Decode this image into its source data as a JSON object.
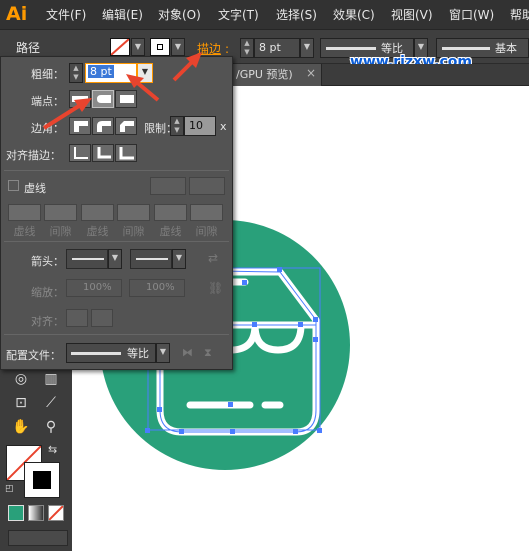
{
  "app": {
    "logo": "Ai"
  },
  "menu": [
    "文件(F)",
    "编辑(E)",
    "对象(O)",
    "文字(T)",
    "选择(S)",
    "效果(C)",
    "视图(V)",
    "窗口(W)",
    "帮助"
  ],
  "control_bar": {
    "path_label": "路径",
    "stroke_link": "描边",
    "stroke_weight": "8 pt",
    "profile_label": "等比",
    "brush_label": "基本"
  },
  "watermark": "www.rjzxw.com",
  "document_tab": {
    "label": "/GPU 预览)",
    "close": "×"
  },
  "stroke_panel": {
    "weight_label": "粗细：",
    "weight_value": "8 pt",
    "cap_label": "端点：",
    "corner_label": "边角：",
    "limit_label": "限制：",
    "limit_value": "10",
    "limit_unit": "x",
    "align_label": "对齐描边：",
    "dashed_label": "虚线",
    "dash_fields": [
      "虚线",
      "间隙",
      "虚线",
      "间隙",
      "虚线",
      "间隙"
    ],
    "arrowheads_label": "箭头：",
    "scale_label": "缩放：",
    "scale_start": "100%",
    "scale_end": "100%",
    "align_arrow_label": "对齐：",
    "profile_label": "配置文件：",
    "profile_value": "等比"
  },
  "colors": {
    "circle": "#29a07a",
    "accent_orange": "#ff9800",
    "arrow_red": "#e8442e",
    "selection_blue": "#4a7cff"
  }
}
